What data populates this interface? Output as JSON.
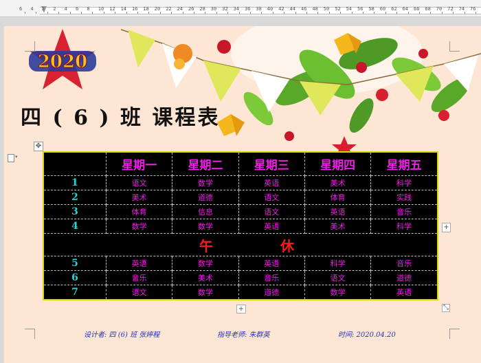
{
  "ruler": {
    "numbers": [
      "6",
      "4",
      "2",
      "2",
      "4",
      "6",
      "8",
      "10",
      "12",
      "14",
      "16",
      "18",
      "20",
      "22",
      "24",
      "26",
      "28",
      "30",
      "32",
      "34",
      "36",
      "38",
      "40",
      "42",
      "44",
      "46",
      "48",
      "50",
      "52",
      "54",
      "56",
      "58",
      "60",
      "62",
      "64",
      "66",
      "68",
      "70",
      "72",
      "74",
      "76"
    ]
  },
  "document": {
    "badge_text": "2020",
    "title": "四 ( 6 ) 班   课程表",
    "table": {
      "headers": [
        "星期一",
        "星期二",
        "星期三",
        "星期四",
        "星期五"
      ],
      "morning": [
        {
          "period": "1",
          "subjects": [
            "语文",
            "数学",
            "英语",
            "美术",
            "科学"
          ]
        },
        {
          "period": "2",
          "subjects": [
            "美术",
            "道德",
            "语文",
            "体育",
            "实践"
          ]
        },
        {
          "period": "3",
          "subjects": [
            "体育",
            "信息",
            "语文",
            "英语",
            "音乐"
          ]
        },
        {
          "period": "4",
          "subjects": [
            "数学",
            "数学",
            "英语",
            "美术",
            "科学"
          ]
        }
      ],
      "lunch": [
        "午",
        "休"
      ],
      "afternoon": [
        {
          "period": "5",
          "subjects": [
            "英语",
            "数学",
            "英语",
            "科学",
            "音乐"
          ]
        },
        {
          "period": "6",
          "subjects": [
            "音乐",
            "美术",
            "音乐",
            "语文",
            "道德"
          ]
        },
        {
          "period": "7",
          "subjects": [
            "语文",
            "数学",
            "道德",
            "数学",
            "英语"
          ]
        }
      ]
    },
    "footer": {
      "designer": "设计者: 四 (6) 班  张婷程",
      "teacher": "指导老师: 朱群英",
      "date": "时间:  2020.04.20"
    }
  },
  "colors": {
    "header": "#ee1ee6",
    "period": "#27d2d6",
    "lunch": "#ff1a1a",
    "table_bg": "#000000",
    "table_border": "#d8d800",
    "page": "#fde6d3"
  }
}
